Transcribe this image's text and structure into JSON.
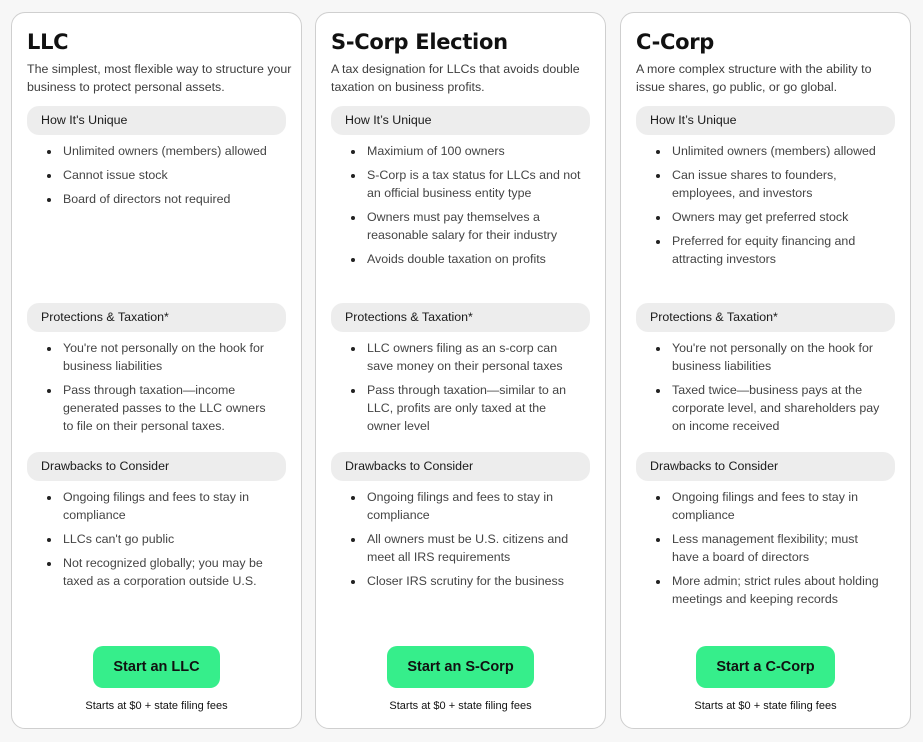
{
  "colors": {
    "cta_background": "#36ee8b",
    "pill_background": "#ededed",
    "card_border": "#cfcfcf",
    "page_background": "#f7f7f7"
  },
  "section_labels": {
    "unique": "How It’s Unique",
    "protections": "Protections & Taxation*",
    "drawbacks": "Drawbacks to Consider"
  },
  "cards": [
    {
      "title": "LLC",
      "subtitle": "The simplest, most flexible way to structure your business to protect personal assets.",
      "unique_label": "How It's Unique",
      "unique": [
        "Unlimited owners (members) allowed",
        "Cannot issue stock",
        "Board of directors not required"
      ],
      "protections_label": "Protections & Taxation*",
      "protections": [
        "You're not personally on the hook for business liabilities",
        "Pass through taxation—income generated passes to the LLC owners to file on their personal taxes."
      ],
      "drawbacks_label": "Drawbacks to Consider",
      "drawbacks": [
        "Ongoing filings and fees to stay in compliance",
        "LLCs can't go public",
        "Not recognized globally; you may be taxed as a corporation outside U.S."
      ],
      "cta_label": "Start an LLC",
      "fee_note": "Starts at $0 + state filing fees"
    },
    {
      "title": "S-Corp Election",
      "subtitle": "A tax designation for LLCs that avoids double taxation on business profits.",
      "unique_label": "How It’s Unique",
      "unique": [
        "Maximium of 100 owners",
        "S-Corp is a tax status for LLCs and not an official business entity type",
        "Owners must pay themselves a reasonable salary for their industry",
        "Avoids double taxation on profits"
      ],
      "protections_label": "Protections & Taxation*",
      "protections": [
        "LLC owners filing as an s-corp can save money on their personal taxes",
        "Pass through taxation—similar to an LLC, profits are only taxed at the owner level"
      ],
      "drawbacks_label": "Drawbacks to Consider",
      "drawbacks": [
        "Ongoing filings and fees to stay in compliance",
        "All owners must be U.S. citizens and meet all IRS requirements",
        "Closer IRS scrutiny for the business"
      ],
      "cta_label": "Start an S-Corp",
      "fee_note": "Starts at $0 + state filing fees"
    },
    {
      "title": "C-Corp",
      "subtitle": "A more complex structure with the ability to issue shares, go public, or go global.",
      "unique_label": "How It’s Unique",
      "unique": [
        "Unlimited owners (members) allowed",
        "Can issue shares to founders, employees, and investors",
        "Owners may get preferred stock",
        "Preferred for equity financing and attracting investors"
      ],
      "protections_label": "Protections & Taxation*",
      "protections": [
        "You're not personally on the hook for business liabilities",
        "Taxed twice—business pays at the corporate level, and shareholders pay on income received"
      ],
      "drawbacks_label": "Drawbacks to Consider",
      "drawbacks": [
        "Ongoing filings and fees to stay in compliance",
        "Less management flexibility; must have a board of directors",
        "More admin; strict rules about holding meetings and keeping records"
      ],
      "cta_label": "Start a C-Corp",
      "fee_note": "Starts at $0 + state filing fees"
    }
  ]
}
